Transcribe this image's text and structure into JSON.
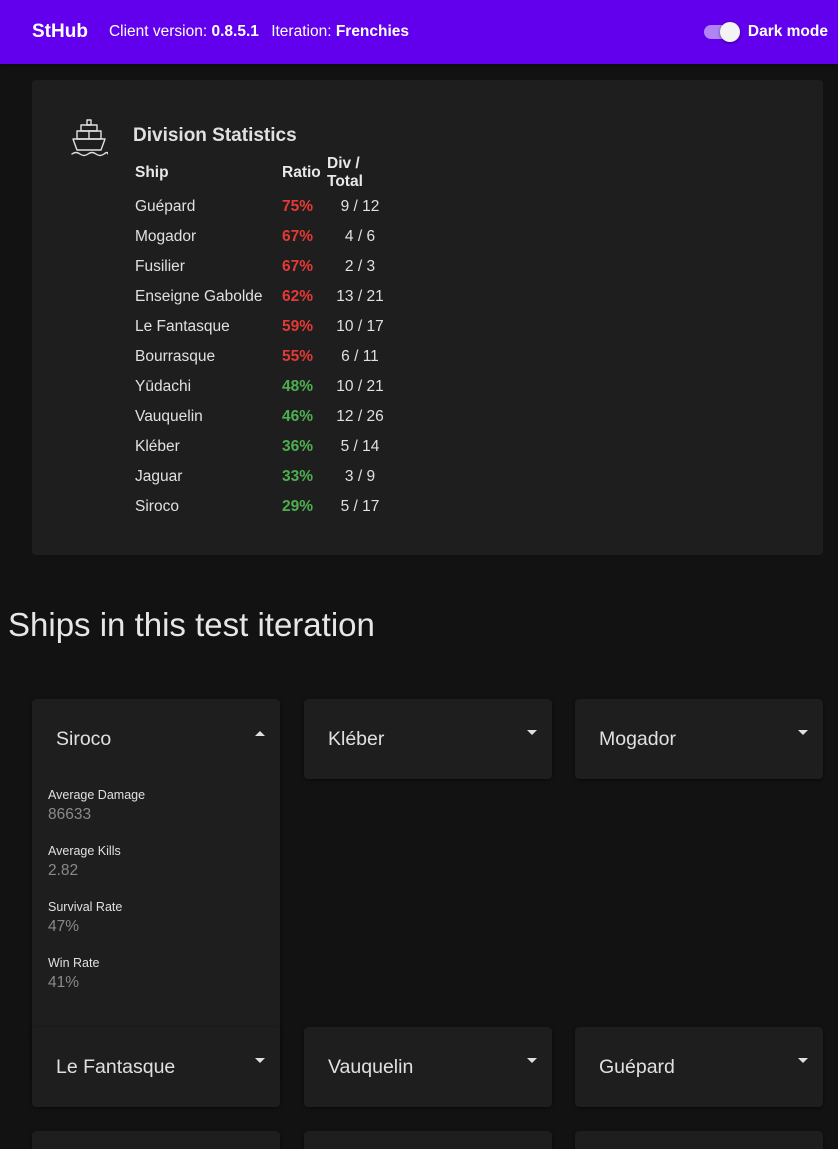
{
  "app": {
    "title": "StHub",
    "client_version_label": "Client version:",
    "client_version": "0.8.5.1",
    "iteration_label": "Iteration:",
    "iteration": "Frenchies",
    "dark_mode_label": "Dark mode",
    "dark_mode_on": true,
    "accent_color": "#6200ee"
  },
  "division_stats": {
    "icon": "ship-icon",
    "title": "Division Statistics",
    "headers": {
      "ship": "Ship",
      "ratio": "Ratio",
      "div_total": "Div / Total"
    },
    "rows": [
      {
        "ship": "Guépard",
        "ratio": "75%",
        "div_total": "9 / 12",
        "status": "red"
      },
      {
        "ship": "Mogador",
        "ratio": "67%",
        "div_total": "4 / 6",
        "status": "red"
      },
      {
        "ship": "Fusilier",
        "ratio": "67%",
        "div_total": "2 / 3",
        "status": "red"
      },
      {
        "ship": "Enseigne Gabolde",
        "ratio": "62%",
        "div_total": "13 / 21",
        "status": "red"
      },
      {
        "ship": "Le Fantasque",
        "ratio": "59%",
        "div_total": "10 / 17",
        "status": "red"
      },
      {
        "ship": "Bourrasque",
        "ratio": "55%",
        "div_total": "6 / 11",
        "status": "red"
      },
      {
        "ship": "Yūdachi",
        "ratio": "48%",
        "div_total": "10 / 21",
        "status": "green"
      },
      {
        "ship": "Vauquelin",
        "ratio": "46%",
        "div_total": "12 / 26",
        "status": "green"
      },
      {
        "ship": "Kléber",
        "ratio": "36%",
        "div_total": "5 / 14",
        "status": "green"
      },
      {
        "ship": "Jaguar",
        "ratio": "33%",
        "div_total": "3 / 9",
        "status": "green"
      },
      {
        "ship": "Siroco",
        "ratio": "29%",
        "div_total": "5 / 17",
        "status": "green"
      }
    ],
    "status_colors": {
      "red": "#e53935",
      "green": "#4caf50"
    }
  },
  "ships_section": {
    "heading": "Ships in this test iteration",
    "cards": [
      {
        "name": "Siroco",
        "expanded": true,
        "stats": [
          {
            "label": "Average Damage",
            "value": "86633"
          },
          {
            "label": "Average Kills",
            "value": "2.82"
          },
          {
            "label": "Survival Rate",
            "value": "47%"
          },
          {
            "label": "Win Rate",
            "value": "41%"
          }
        ]
      },
      {
        "name": "Kléber",
        "expanded": false
      },
      {
        "name": "Mogador",
        "expanded": false
      },
      {
        "name": "Le Fantasque",
        "expanded": false
      },
      {
        "name": "Vauquelin",
        "expanded": false
      },
      {
        "name": "Guépard",
        "expanded": false
      },
      {
        "name": "",
        "expanded": false
      },
      {
        "name": "",
        "expanded": false
      },
      {
        "name": "",
        "expanded": false
      }
    ]
  }
}
